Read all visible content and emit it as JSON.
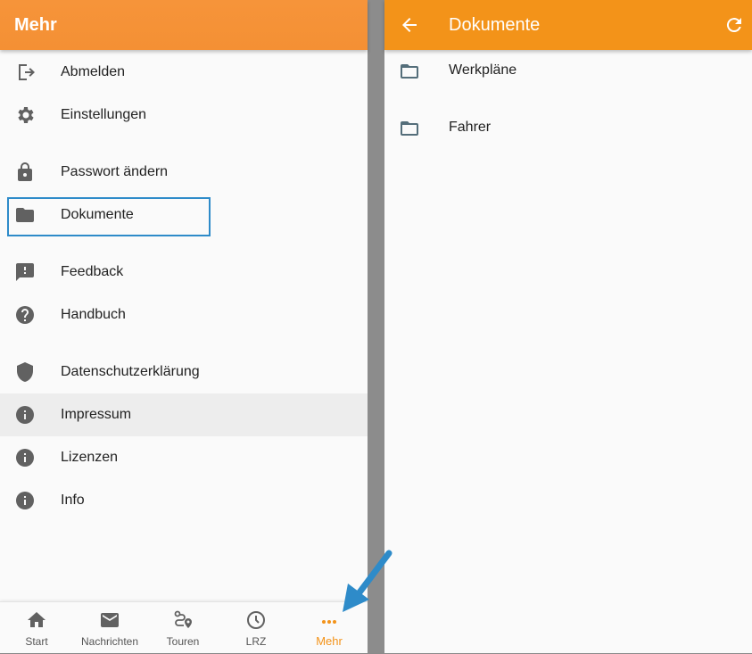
{
  "left_panel": {
    "title": "Mehr",
    "menu": [
      {
        "label": "Abmelden",
        "icon": "logout-icon"
      },
      {
        "label": "Einstellungen",
        "icon": "gear-icon"
      },
      {
        "label": "Passwort ändern",
        "icon": "lock-icon"
      },
      {
        "label": "Dokumente",
        "icon": "folder-icon"
      },
      {
        "label": "Feedback",
        "icon": "feedback-icon"
      },
      {
        "label": "Handbuch",
        "icon": "help-icon"
      },
      {
        "label": "Datenschutzerklärung",
        "icon": "shield-icon"
      },
      {
        "label": "Impressum",
        "icon": "info-icon"
      },
      {
        "label": "Lizenzen",
        "icon": "info-icon"
      },
      {
        "label": "Info",
        "icon": "info-icon"
      }
    ],
    "bottom_nav": [
      {
        "label": "Start",
        "icon": "home-icon"
      },
      {
        "label": "Nachrichten",
        "icon": "mail-icon"
      },
      {
        "label": "Touren",
        "icon": "route-icon"
      },
      {
        "label": "LRZ",
        "icon": "clock-icon"
      },
      {
        "label": "Mehr",
        "icon": "more-icon"
      }
    ]
  },
  "right_panel": {
    "title": "Dokumente",
    "folders": [
      {
        "label": "Werkpläne",
        "icon": "folder-outline-icon"
      },
      {
        "label": "Fahrer",
        "icon": "folder-outline-icon"
      }
    ]
  },
  "colors": {
    "accent": "#f39319",
    "highlight_border": "#2e8bc9",
    "annotation_arrow": "#2e8bc9",
    "icon_gray": "#616161"
  }
}
